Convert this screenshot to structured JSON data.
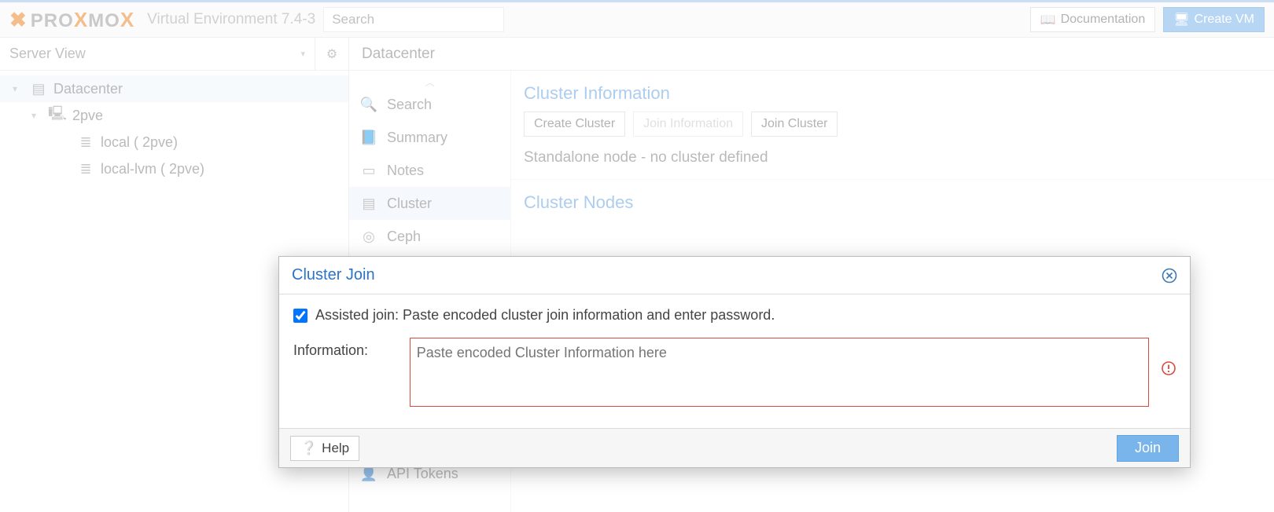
{
  "header": {
    "logo_text": "PROXMOX",
    "env_label": "Virtual Environment 7.4-3",
    "search_placeholder": "Search",
    "doc_label": "Documentation",
    "create_vm_label": "Create VM"
  },
  "tree": {
    "view_label": "Server View",
    "datacenter": "Datacenter",
    "node": "2pve",
    "storage_local": "local (   2pve)",
    "storage_lvm": "local-lvm (   2pve)"
  },
  "main": {
    "breadcrumb": "Datacenter",
    "menu": {
      "search": "Search",
      "summary": "Summary",
      "notes": "Notes",
      "cluster": "Cluster",
      "ceph": "Ceph",
      "api_tokens": "API Tokens"
    },
    "cluster": {
      "info_title": "Cluster Information",
      "btn_create": "Create Cluster",
      "btn_joininfo": "Join Information",
      "btn_joincluster": "Join Cluster",
      "standalone": "Standalone node - no cluster defined",
      "nodes_title": "Cluster Nodes"
    }
  },
  "modal": {
    "title": "Cluster Join",
    "assisted_label": "Assisted join: Paste encoded cluster join information and enter password.",
    "info_label": "Information:",
    "info_placeholder": "Paste encoded Cluster Information here",
    "help_label": "Help",
    "join_label": "Join"
  }
}
